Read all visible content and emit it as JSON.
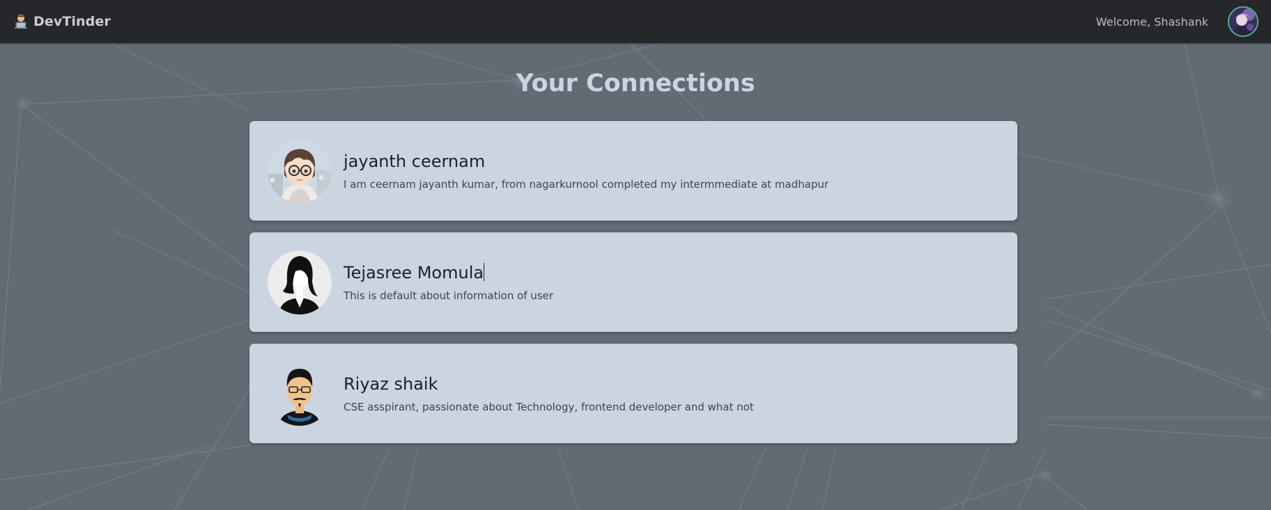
{
  "app": {
    "brand_name": "DevTinder",
    "brand_icon": "developer-emoji-icon",
    "welcome_text": "Welcome, Shashank"
  },
  "page": {
    "title": "Your Connections"
  },
  "connections": [
    {
      "name": "jayanth ceernam",
      "about": "I am ceernam jayanth kumar, from nagarkurnool completed my intermmediate at madhapur",
      "avatar": "anime-boy-glasses-avatar"
    },
    {
      "name": "Tejasree Momula",
      "about": "This is default about information of user",
      "avatar": "default-female-silhouette-avatar"
    },
    {
      "name": "Riyaz shaik",
      "about": "CSE asspirant, passionate about Technology, frontend developer and what not",
      "avatar": "cartoon-man-glasses-avatar"
    }
  ],
  "colors": {
    "navbar_bg": "#26272b",
    "page_bg": "#636a73",
    "card_bg": "#cbd5e1",
    "title_color": "#cbd5e1",
    "avatar_ring": "#46b98a"
  }
}
